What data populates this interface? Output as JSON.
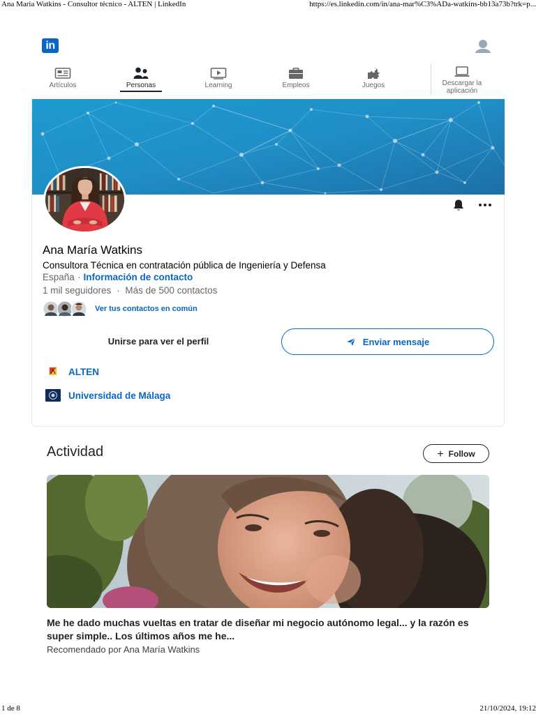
{
  "print": {
    "title": "Ana Maria Watkins - Consultor técnico - ALTEN | LinkedIn",
    "url": "https://es.linkedin.com/in/ana-mar%C3%ADa-watkins-bb13a73b?trk=p...",
    "page": "1 de 8",
    "datetime": "21/10/2024, 19:12"
  },
  "header": {
    "logo_text": "in"
  },
  "nav": {
    "items": [
      {
        "label": "Artículos",
        "icon": "articles-icon",
        "active": false
      },
      {
        "label": "Personas",
        "icon": "people-icon",
        "active": true
      },
      {
        "label": "Learning",
        "icon": "learning-icon",
        "active": false
      },
      {
        "label": "Empleos",
        "icon": "jobs-icon",
        "active": false
      },
      {
        "label": "Juegos",
        "icon": "games-icon",
        "active": false
      },
      {
        "label": "Descargar la aplicación",
        "icon": "download-app-icon",
        "active": false
      }
    ]
  },
  "profile": {
    "name": "Ana María Watkins",
    "headline": "Consultora Técnica en contratación pública de Ingeniería y Defensa",
    "location": "España",
    "location_separator": "·",
    "contact_info_link": "Información de contacto",
    "followers": "1 mil seguidores",
    "stats_separator": "·",
    "connections": "Más de 500 contactos",
    "mutual_link": "Ver tus contactos en común",
    "join_button": "Unirse para ver el perfil",
    "message_button": "Enviar mensaje",
    "organizations": [
      {
        "name": "ALTEN",
        "logo": "alten-logo"
      },
      {
        "name": "Universidad de Málaga",
        "logo": "uma-logo"
      }
    ]
  },
  "activity": {
    "title": "Actividad",
    "follow_button": "Follow",
    "post": {
      "title": "Me he dado muchas vueltas en tratar de diseñar mi negocio autónomo legal... y la razón es super simple.. Los últimos años me he...",
      "meta": "Recomendado por Ana María Watkins"
    }
  },
  "colors": {
    "brand_blue": "#0a66c2",
    "banner_start": "#1f9ad0",
    "banner_end": "#1c6fa6",
    "text_primary": "#1d2226",
    "text_secondary": "#666666"
  }
}
